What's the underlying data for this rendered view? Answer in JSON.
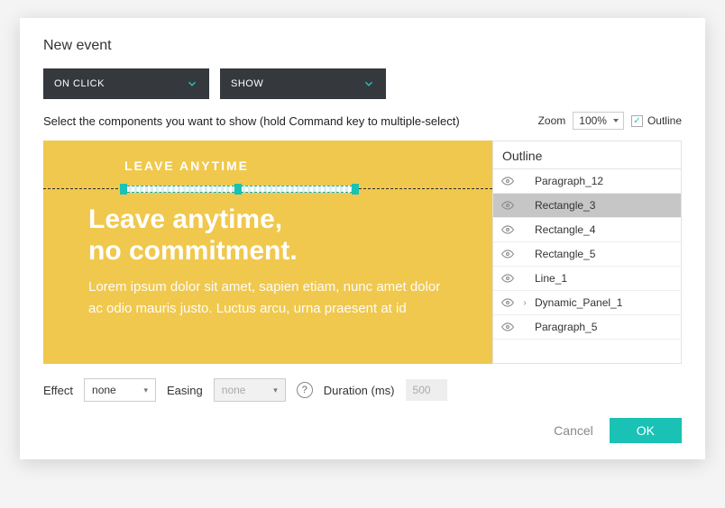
{
  "title": "New event",
  "trigger": {
    "label": "ON CLICK"
  },
  "action": {
    "label": "SHOW"
  },
  "instruction": "Select the components you want to show (hold Command key to multiple-select)",
  "zoom": {
    "label": "Zoom",
    "value": "100%"
  },
  "outline_toggle": {
    "label": "Outline",
    "checked": true
  },
  "canvas": {
    "heading": "LEAVE ANYTIME",
    "title_line1": "Leave anytime,",
    "title_line2": "no commitment.",
    "body": "Lorem ipsum dolor sit amet, sapien etiam, nunc amet dolor ac odio mauris justo. Luctus arcu, urna praesent at id"
  },
  "outline": {
    "title": "Outline",
    "items": [
      {
        "label": "Paragraph_12",
        "expandable": false,
        "selected": false
      },
      {
        "label": "Rectangle_3",
        "expandable": false,
        "selected": true
      },
      {
        "label": "Rectangle_4",
        "expandable": false,
        "selected": false
      },
      {
        "label": "Rectangle_5",
        "expandable": false,
        "selected": false
      },
      {
        "label": "Line_1",
        "expandable": false,
        "selected": false
      },
      {
        "label": "Dynamic_Panel_1",
        "expandable": true,
        "selected": false
      },
      {
        "label": "Paragraph_5",
        "expandable": false,
        "selected": false
      }
    ]
  },
  "effect": {
    "label": "Effect",
    "value": "none"
  },
  "easing": {
    "label": "Easing",
    "value": "none"
  },
  "duration": {
    "label": "Duration (ms)",
    "value": "500"
  },
  "buttons": {
    "cancel": "Cancel",
    "ok": "OK"
  }
}
